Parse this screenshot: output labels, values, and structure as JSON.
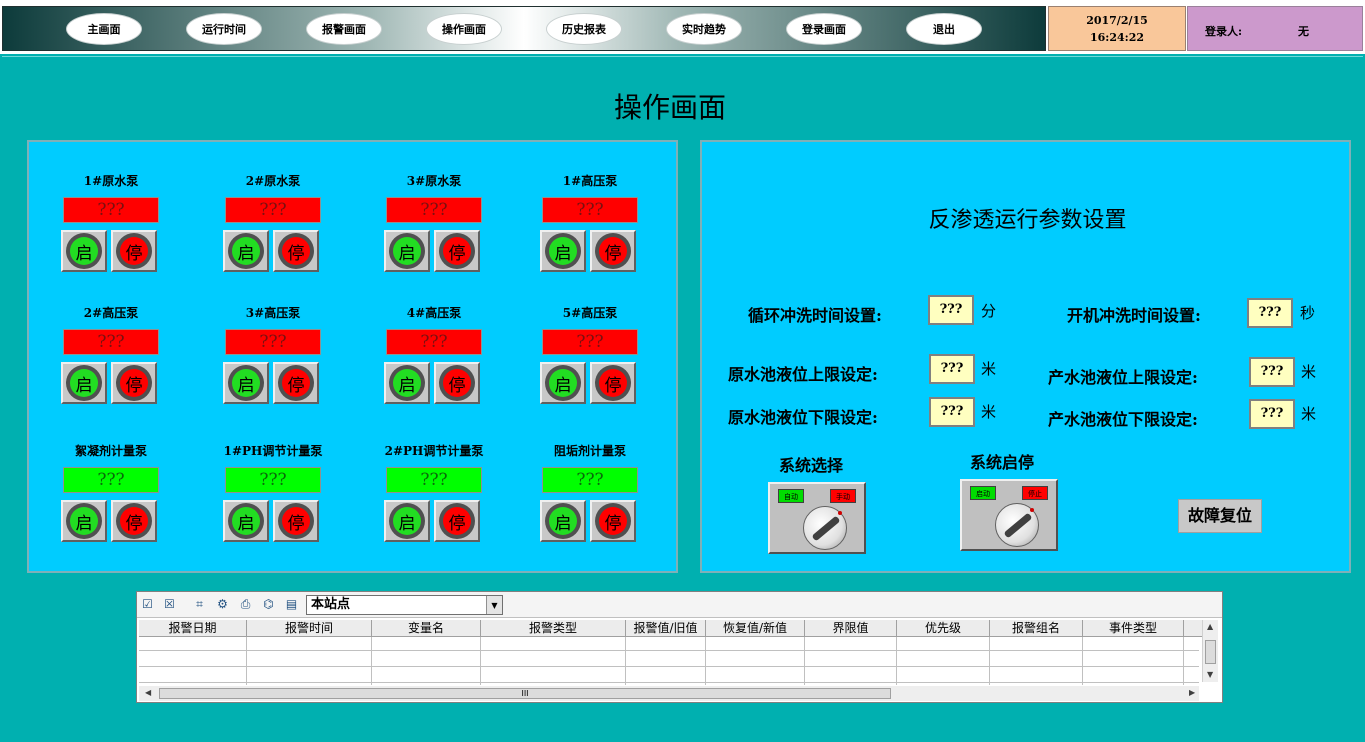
{
  "nav": {
    "items": [
      "主画面",
      "运行时间",
      "报警画面",
      "操作画面",
      "历史报表",
      "实时趋势",
      "登录画面",
      "退出"
    ]
  },
  "datetime": {
    "date": "2017/2/15",
    "time": "16:24:22"
  },
  "login": {
    "label": "登录人:",
    "user": "无"
  },
  "page_title": "操作画面",
  "pumps": [
    {
      "name": "1#原水泵",
      "status": "???",
      "status_color": "red"
    },
    {
      "name": "2#原水泵",
      "status": "???",
      "status_color": "red"
    },
    {
      "name": "3#原水泵",
      "status": "???",
      "status_color": "red"
    },
    {
      "name": "1#高压泵",
      "status": "???",
      "status_color": "red"
    },
    {
      "name": "2#高压泵",
      "status": "???",
      "status_color": "red"
    },
    {
      "name": "3#高压泵",
      "status": "???",
      "status_color": "red"
    },
    {
      "name": "4#高压泵",
      "status": "???",
      "status_color": "red"
    },
    {
      "name": "5#高压泵",
      "status": "???",
      "status_color": "red"
    },
    {
      "name": "絮凝剂计量泵",
      "status": "???",
      "status_color": "green"
    },
    {
      "name": "1#PH调节计量泵",
      "status": "???",
      "status_color": "green"
    },
    {
      "name": "2#PH调节计量泵",
      "status": "???",
      "status_color": "green"
    },
    {
      "name": "阻垢剂计量泵",
      "status": "???",
      "status_color": "green"
    }
  ],
  "pump_buttons": {
    "start": "启",
    "stop": "停"
  },
  "params": {
    "title": "反渗透运行参数设置",
    "cycle_flush_label": "循环冲洗时间设置:",
    "cycle_flush_value": "???",
    "cycle_flush_unit": "分",
    "start_flush_label": "开机冲洗时间设置:",
    "start_flush_value": "???",
    "start_flush_unit": "秒",
    "raw_upper_label": "原水池液位上限设定:",
    "raw_upper_value": "???",
    "raw_upper_unit": "米",
    "prod_upper_label": "产水池液位上限设定:",
    "prod_upper_value": "???",
    "prod_upper_unit": "米",
    "raw_lower_label": "原水池液位下限设定:",
    "raw_lower_value": "???",
    "raw_lower_unit": "米",
    "prod_lower_label": "产水池液位下限设定:",
    "prod_lower_value": "???",
    "prod_lower_unit": "米",
    "system_select_label": "系统选择",
    "system_select_left": "自动",
    "system_select_right": "手动",
    "system_startstop_label": "系统启停",
    "system_startstop_left": "启动",
    "system_startstop_right": "停止",
    "reset_label": "故障复位"
  },
  "alarm": {
    "station": "本站点",
    "columns": [
      "报警日期",
      "报警时间",
      "变量名",
      "报警类型",
      "报警值/旧值",
      "恢复值/新值",
      "界限值",
      "优先级",
      "报警组名",
      "事件类型"
    ],
    "hscroll_label": "III"
  },
  "colors": {
    "background": "#00b0b0",
    "panel": "#00ccff",
    "status_red": "#ff0000",
    "status_green": "#00ff00",
    "param_field": "#ffffc0"
  }
}
